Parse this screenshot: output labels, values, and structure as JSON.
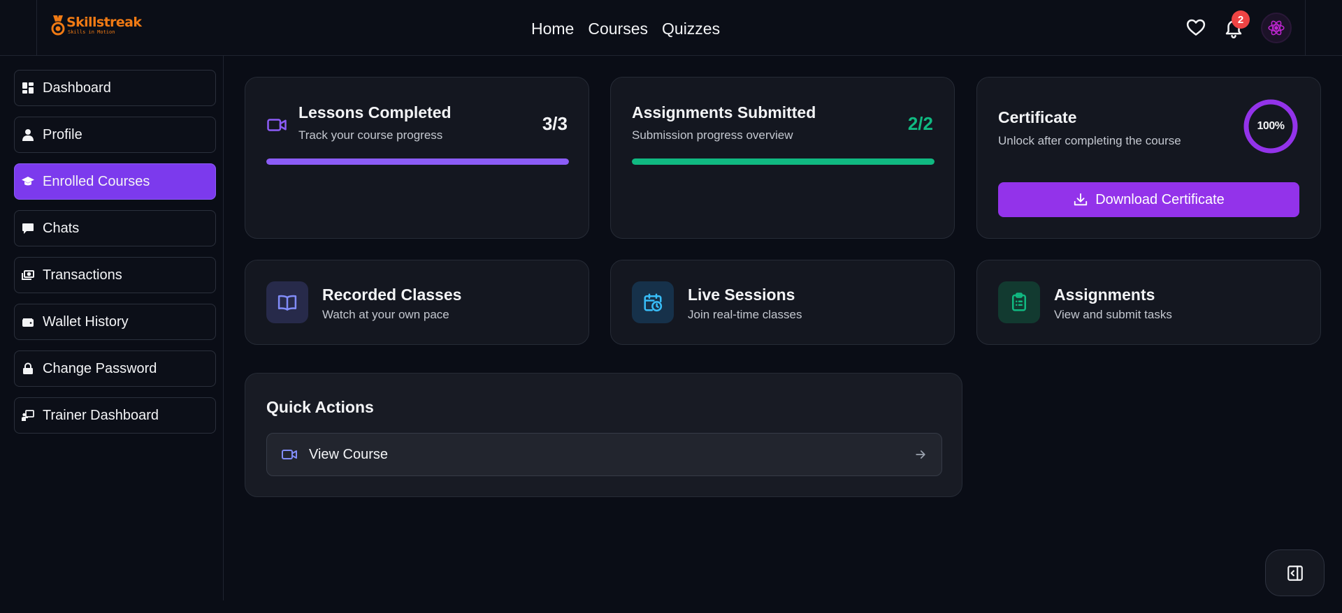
{
  "header": {
    "logo": {
      "name": "Skillstreak",
      "tagline": "Skills in Motion"
    },
    "nav": [
      "Home",
      "Courses",
      "Quizzes"
    ],
    "notification_count": "2"
  },
  "sidebar": {
    "items": [
      {
        "label": "Dashboard",
        "icon": "dashboard-icon",
        "active": false
      },
      {
        "label": "Profile",
        "icon": "user-icon",
        "active": false
      },
      {
        "label": "Enrolled Courses",
        "icon": "graduation-cap-icon",
        "active": true
      },
      {
        "label": "Chats",
        "icon": "chat-icon",
        "active": false
      },
      {
        "label": "Transactions",
        "icon": "money-icon",
        "active": false
      },
      {
        "label": "Wallet History",
        "icon": "wallet-icon",
        "active": false
      },
      {
        "label": "Change Password",
        "icon": "lock-icon",
        "active": false
      },
      {
        "label": "Trainer Dashboard",
        "icon": "chalkboard-icon",
        "active": false
      }
    ]
  },
  "stats": {
    "lessons": {
      "title": "Lessons Completed",
      "subtitle": "Track your course progress",
      "value": "3/3",
      "progress": 1.0,
      "color": "#8b5cf6"
    },
    "assignments": {
      "title": "Assignments Submitted",
      "subtitle": "Submission progress overview",
      "value": "2/2",
      "progress": 1.0,
      "color": "#10b981"
    },
    "certificate": {
      "title": "Certificate",
      "subtitle": "Unlock after completing the course",
      "percent": "100%",
      "button_label": "Download Certificate",
      "color": "#9333ea"
    }
  },
  "features": [
    {
      "title": "Recorded Classes",
      "subtitle": "Watch at your own pace",
      "icon": "book-open-icon",
      "color": "#818cf8"
    },
    {
      "title": "Live Sessions",
      "subtitle": "Join real-time classes",
      "icon": "calendar-clock-icon",
      "color": "#38bdf8"
    },
    {
      "title": "Assignments",
      "subtitle": "View and submit tasks",
      "icon": "clipboard-list-icon",
      "color": "#10b981"
    }
  ],
  "quick_actions": {
    "title": "Quick Actions",
    "items": [
      {
        "label": "View Course",
        "icon": "video-icon"
      }
    ]
  }
}
